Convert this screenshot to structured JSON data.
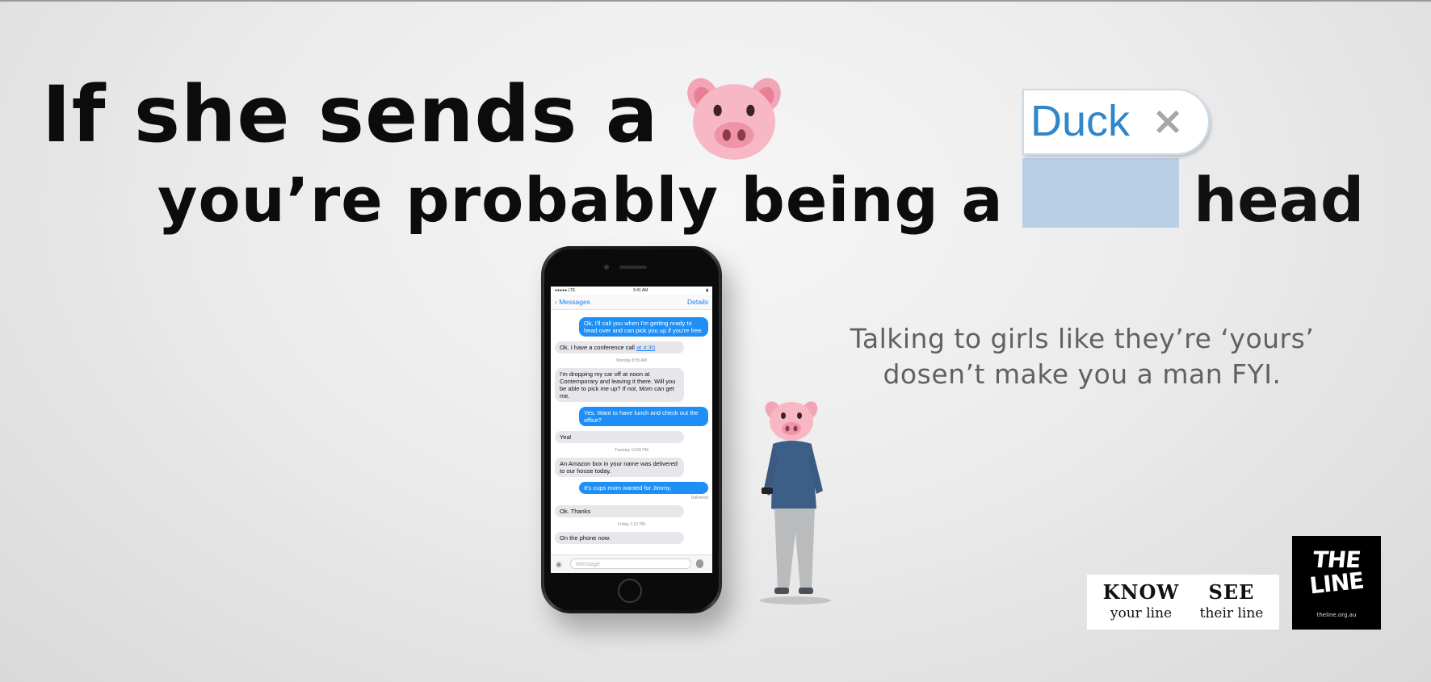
{
  "headline": {
    "line1": "If she sends a",
    "line2": "you’re probably being a",
    "line2_end": "head"
  },
  "autocorrect": {
    "word": "Duck",
    "dismiss": "×"
  },
  "tagline": {
    "line1": "Talking to girls like they’re ‘yours’",
    "line2": "dosen’t make you a man FYI."
  },
  "phone": {
    "status_left": "●●●●● LTE",
    "status_center": "9:41 AM",
    "status_right": "▮",
    "back_label": "‹ Messages",
    "details_label": "Details",
    "input_placeholder": "iMessage",
    "messages": [
      {
        "type": "out",
        "text": "Ok, I'll call you when I'm getting ready to head over and can pick you up if you're free."
      },
      {
        "type": "in",
        "text": "Ok, I have a conference call ",
        "link": "at 4:30",
        "after": "."
      },
      {
        "type": "stamp",
        "text": "Monday 8:55 AM"
      },
      {
        "type": "in",
        "text": "I'm dropping my car off at noon at Contemporary and leaving it there. Will you be able to pick me up? If not, Mom can get me."
      },
      {
        "type": "out",
        "text": "Yes. Want to have lunch and check out the office?"
      },
      {
        "type": "in",
        "text": "Yea!"
      },
      {
        "type": "stamp",
        "text": "Tuesday 12:50 PM"
      },
      {
        "type": "in",
        "text": "An Amazon box in your name was delivered to our house today."
      },
      {
        "type": "out",
        "text": "It's cups mom wanted for Jimmy."
      },
      {
        "type": "delivered",
        "text": "Delivered"
      },
      {
        "type": "in",
        "text": "Ok. Thanks"
      },
      {
        "type": "stamp",
        "text": "Friday 1:22 PM"
      },
      {
        "type": "in",
        "text": "On the phone now."
      }
    ]
  },
  "logos": {
    "know": "KNOW",
    "know_sub": "your line",
    "see": "SEE",
    "see_sub": "their line",
    "line_the": "THE",
    "line_line": "LINE",
    "line_url": "theline.org.au"
  },
  "colors": {
    "suggest_blue": "#2f86c8",
    "blank_blue": "#b9cfe6",
    "bubble_out": "#1e8ff7",
    "bubble_in": "#e6e6eb"
  },
  "icons": [
    "pig-face-icon",
    "camera-icon",
    "microphone-icon",
    "chevron-left-icon"
  ]
}
